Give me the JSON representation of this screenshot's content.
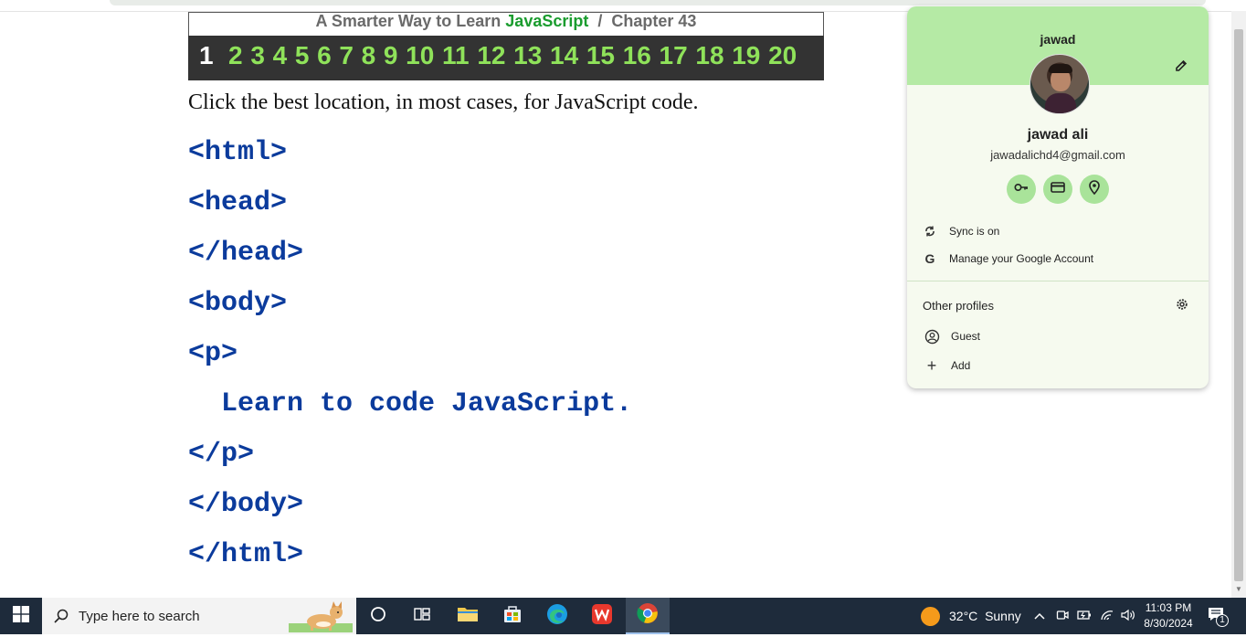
{
  "header": {
    "prefix": "A Smarter Way to Learn",
    "brand": "JavaScript",
    "separator": "/",
    "chapter": "Chapter 43"
  },
  "chapter_nav": {
    "current": "1",
    "items": [
      "2",
      "3",
      "4",
      "5",
      "6",
      "7",
      "8",
      "9",
      "10",
      "11",
      "12",
      "13",
      "14",
      "15",
      "16",
      "17",
      "18",
      "19",
      "20"
    ]
  },
  "question": "Click the best location, in most cases, for JavaScript code.",
  "code_lines": [
    "<html>",
    "<head>",
    "</head>",
    "<body>",
    "<p>",
    "  Learn to code JavaScript.",
    "</p>",
    "</body>",
    "</html>"
  ],
  "profile_popup": {
    "profile_name": "jawad",
    "full_name": "jawad ali",
    "email": "jawadalichd4@gmail.com",
    "sync_label": "Sync is on",
    "manage_label": "Manage your Google Account",
    "other_profiles_label": "Other profiles",
    "guest_label": "Guest",
    "add_label": "Add",
    "icons": [
      "key-icon",
      "credit-card-icon",
      "location-pin-icon"
    ]
  },
  "taskbar": {
    "search_placeholder": "Type here to search",
    "weather_temp": "32°C",
    "weather_desc": "Sunny",
    "time": "11:03 PM",
    "date": "8/30/2024",
    "notification_count": "1"
  },
  "colors": {
    "brand_green": "#1a9c2e",
    "chapter_bar": "#333333",
    "chapter_link": "#8fe25a",
    "code_blue": "#0b3b9c",
    "popup_header": "#b5eaa5"
  }
}
